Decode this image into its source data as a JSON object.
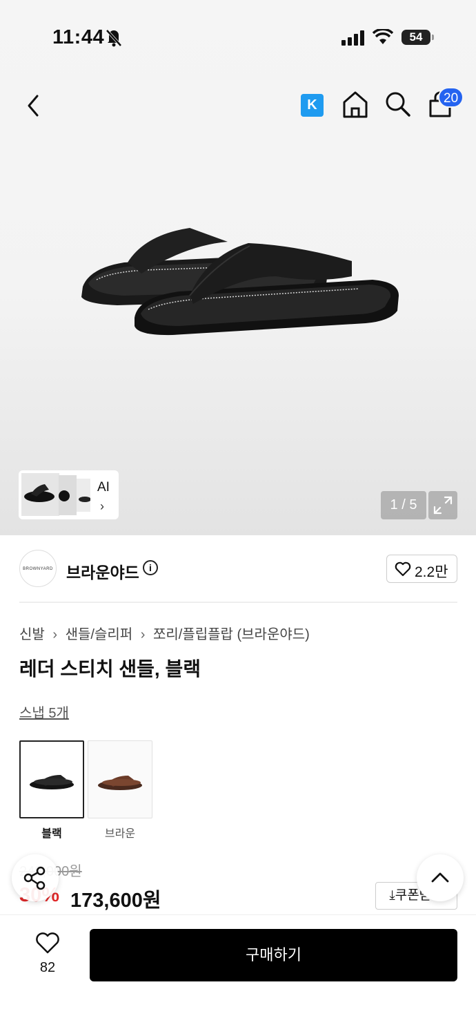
{
  "status_bar": {
    "time": "11:44",
    "battery": "54"
  },
  "header": {
    "cart_count": "20",
    "k_label": "K"
  },
  "gallery": {
    "page_counter": "1 / 5",
    "ai_label": "AI",
    "ai_arrow": "›"
  },
  "brand": {
    "logo_text": "BROWNYARD",
    "name": "브라운야드",
    "likes": "2.2만"
  },
  "breadcrumb": [
    "신발",
    "샌들/슬리퍼",
    "쪼리/플립플랍 (브라운야드)"
  ],
  "breadcrumb_sep": "›",
  "product": {
    "title": "레더 스티치 샌들, 블랙",
    "snap": "스냅 5개",
    "options": [
      {
        "label": "블랙"
      },
      {
        "label": "브라운"
      }
    ],
    "original_price": "248,000원",
    "discount": "30%",
    "price": "173,600원",
    "coupon_label": "⤓쿠폰받기"
  },
  "bottom": {
    "wish_count": "82",
    "buy_label": "구매하기"
  },
  "colors": {
    "accent": "#2463f0",
    "discount": "#e0292a",
    "k_brand": "#1f9bf0"
  },
  "icons": [
    "back-icon",
    "home-icon",
    "search-icon",
    "cart-icon",
    "expand-icon",
    "info-icon",
    "heart-icon",
    "share-icon",
    "chevron-up-icon"
  ]
}
